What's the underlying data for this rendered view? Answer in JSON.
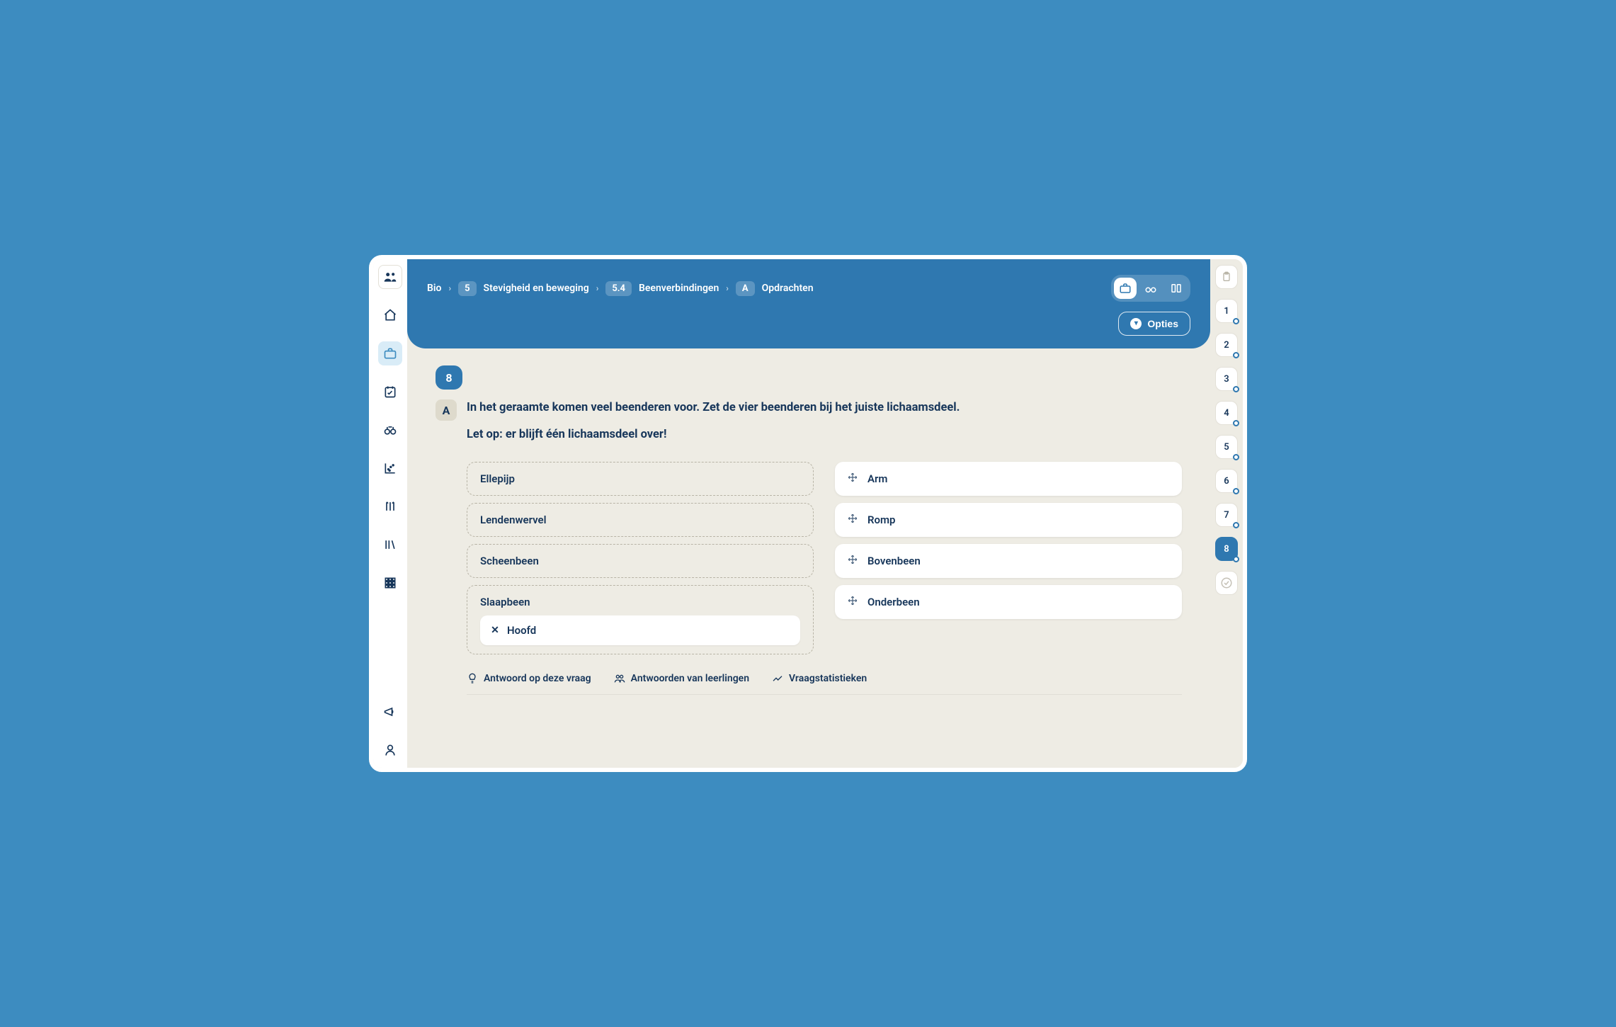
{
  "breadcrumbs": {
    "subject": "Bio",
    "chapter_num": "5",
    "chapter_title": "Stevigheid en beweging",
    "section_num": "5.4",
    "section_title": "Beenverbindingen",
    "part_letter": "A",
    "part_title": "Opdrachten"
  },
  "options_button": "Opties",
  "question": {
    "number": "8",
    "letter": "A",
    "text_line1": "In het geraamte komen veel beenderen voor. Zet de vier beenderen bij het juiste lichaamsdeel.",
    "text_line2": "Let op: er blijft één lichaamsdeel over!"
  },
  "dropzones": [
    {
      "label": "Ellepijp",
      "placed": null
    },
    {
      "label": "Lendenwervel",
      "placed": null
    },
    {
      "label": "Scheenbeen",
      "placed": null
    },
    {
      "label": "Slaapbeen",
      "placed": "Hoofd"
    }
  ],
  "draggables": [
    "Arm",
    "Romp",
    "Bovenbeen",
    "Onderbeen"
  ],
  "footer": {
    "answer": "Antwoord op deze vraag",
    "student_answers": "Antwoorden van leerlingen",
    "stats": "Vraagstatistieken"
  },
  "right_nav": {
    "items": [
      "1",
      "2",
      "3",
      "4",
      "5",
      "6",
      "7",
      "8"
    ],
    "active": "8"
  }
}
